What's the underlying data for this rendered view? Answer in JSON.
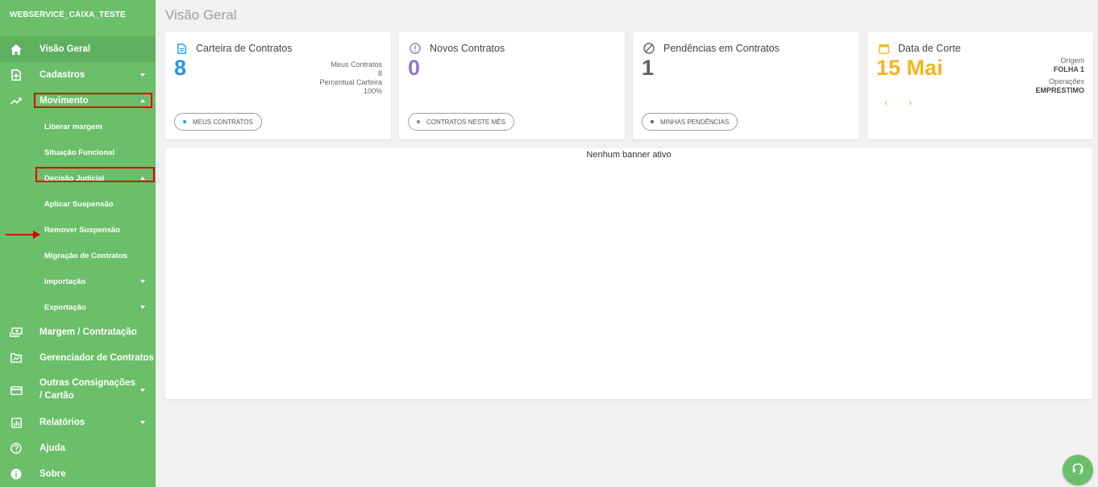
{
  "sidebar": {
    "brand": "WEBSERVICE_CAIXA_TESTE",
    "items": {
      "visao_geral": "Visão Geral",
      "cadastros": "Cadastros",
      "movimento": "Movimento",
      "margem": "Margem / Contratação",
      "gerenciador": "Gerenciador de Contratos",
      "outras": "Outras Consignações / Cartão",
      "relatorios": "Relatórios",
      "ajuda": "Ajuda",
      "sobre": "Sobre"
    },
    "movimento_sub": {
      "liberar": "Liberar margem",
      "situacao": "Situação Funcional",
      "decisao": "Decisão Judicial",
      "aplicar": "Aplicar Suspensão",
      "remover": "Remover Suspensão",
      "migracao": "Migração de Contratos",
      "importacao": "Importação",
      "exportacao": "Exportação"
    }
  },
  "main": {
    "title": "Visão Geral",
    "cards": {
      "carteira": {
        "title": "Carteira de Contratos",
        "value": "8",
        "meta1_label": "Meus Contratos",
        "meta1_value": "8",
        "meta2_label": "Percentual Carteira",
        "meta2_value": "100%",
        "button": "MEUS CONTRATOS"
      },
      "novos": {
        "title": "Novos Contratos",
        "value": "0",
        "button": "CONTRATOS NESTE MÊS"
      },
      "pendencias": {
        "title": "Pendências em Contratos",
        "value": "1",
        "button": "MINHAS PENDÊNCIAS"
      },
      "corte": {
        "title": "Data de Corte",
        "value": "15 Mai",
        "meta1_label": "Origem",
        "meta1_value": "FOLHA 1",
        "meta2_label": "Operações",
        "meta2_value": "EMPRESTIMO",
        "prev": "‹",
        "next": "›"
      }
    },
    "banner_text": "Nenhum banner ativo"
  },
  "colors": {
    "sidebar_bg": "#6bbf6a",
    "carteira_accent": "#2196f3",
    "novos_accent": "#9575cd",
    "pendencias_accent": "#616161",
    "corte_accent": "#f3b51f",
    "highlight": "#e00000"
  },
  "icons": [
    "home-icon",
    "add-document-icon",
    "trending-icon",
    "money-icon",
    "folder-chart-icon",
    "card-icon",
    "report-icon",
    "help-icon",
    "info-icon",
    "document-icon",
    "alert-circle-icon",
    "block-icon",
    "calendar-icon",
    "headset-icon"
  ]
}
